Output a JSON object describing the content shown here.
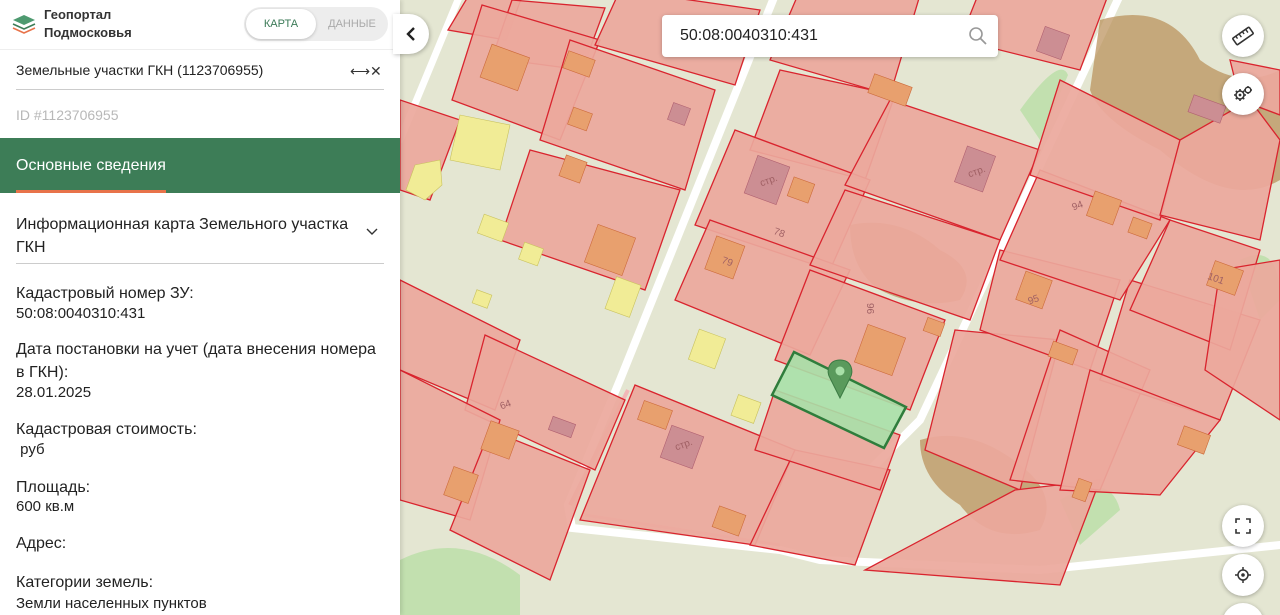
{
  "app": {
    "name_line1": "Геопортал",
    "name_line2": "Подмосковья"
  },
  "mode_toggle": {
    "map_label": "КАРТА",
    "data_label": "ДАННЫЕ",
    "active": "map"
  },
  "layer": {
    "title": "Земельные участки ГКН (1123706955)",
    "id_line": "ID #1123706955"
  },
  "section": {
    "title": "Основные сведения"
  },
  "accordion": {
    "title": "Информационная карта Земельного участка ГКН"
  },
  "fields": [
    {
      "label": "Кадастровый номер ЗУ:",
      "value": "50:08:0040310:431"
    },
    {
      "label": "Дата постановки на учет (дата внесения номера в ГКН):",
      "value": "28.01.2025"
    },
    {
      "label": "Кадастровая стоимость:",
      "value": " руб"
    },
    {
      "label": "Площадь:",
      "value": "600 кв.м"
    },
    {
      "label": "Адрес:",
      "value": ""
    },
    {
      "label": "Категории земель:",
      "value": "Земли населенных пунктов"
    }
  ],
  "search": {
    "value": "50:08:0040310:431"
  },
  "map": {
    "parcel_labels": [
      "стр.",
      "стр.",
      "78",
      "79",
      "96",
      "95",
      "94",
      "101",
      "64",
      "стр."
    ]
  },
  "colors": {
    "accent_green": "#3d7d57",
    "accent_orange": "#e8734a",
    "parcel_fill": "#eba89c",
    "parcel_border": "#d9242e",
    "building_fill": "#e8a06e",
    "selected_parcel_fill": "#a8e0a8",
    "selected_parcel_border": "#2f7d3c"
  },
  "icons": {
    "logo": "layers-icon",
    "collapse": "chevron-left-icon",
    "search": "search-icon",
    "ruler": "ruler-icon",
    "settings": "gears-icon",
    "fullscreen": "fullscreen-icon",
    "locate": "crosshair-icon",
    "pin": "map-pin-icon"
  }
}
